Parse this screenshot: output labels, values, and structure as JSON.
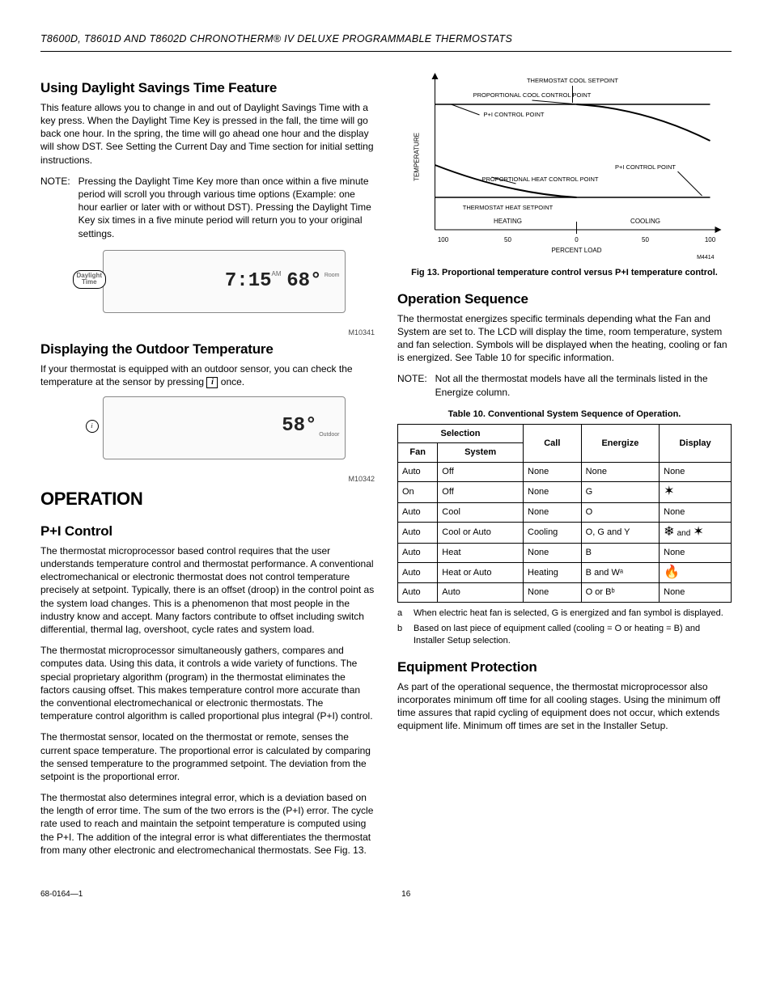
{
  "header": {
    "title": "T8600D, T8601D AND T8602D CHRONOTHERM® IV DELUXE PROGRAMMABLE THERMOSTATS"
  },
  "left": {
    "h_daylight": "Using Daylight Savings Time Feature",
    "p_daylight": "This feature allows you to change in and out of Daylight Savings Time with a key press. When the Daylight Time Key is pressed in the fall, the time will go back one hour. In the spring, the time will go ahead one hour and the display will show DST. See Setting the Current Day and Time section for initial setting instructions.",
    "note_label": "NOTE:",
    "note_daylight": "Pressing the Daylight Time Key more than once within a five minute period will scroll you through various time options (Example: one hour earlier or later with or without DST). Pressing the Daylight Time Key six times in a five minute period will return you to your original settings.",
    "fig1_chip": "Daylight\nTime",
    "fig1_time": "7:15",
    "fig1_ampm": "AM",
    "fig1_temp": "68°",
    "fig1_room": "Room",
    "fig1_code": "M10341",
    "h_outdoor": "Displaying the Outdoor Temperature",
    "p_outdoor_a": "If your thermostat is equipped with an outdoor sensor, you can check the temperature at the sensor by pressing ",
    "p_outdoor_b": " once.",
    "fig2_temp": "58°",
    "fig2_label": "Outdoor",
    "fig2_code": "M10342",
    "h_operation": "OPERATION",
    "h_pi": "P+I Control",
    "p_pi1": "The thermostat microprocessor based control requires that the user understands temperature control and thermostat performance. A conventional electromechanical or electronic thermostat does not control temperature precisely at setpoint. Typically, there is an offset (droop) in the control point as the system load changes. This is a phenomenon that most people in the industry know and accept. Many factors contribute to offset including switch differential, thermal lag, overshoot, cycle rates and system load.",
    "p_pi2": "The thermostat microprocessor simultaneously gathers, compares and computes data. Using this data, it controls a wide variety of functions. The special proprietary algorithm (program) in the thermostat eliminates the factors causing offset. This makes temperature control more accurate than the conventional electromechanical or electronic thermostats. The temperature control algorithm is called proportional plus integral (P+I) control.",
    "p_pi3": "The thermostat sensor, located on the thermostat or remote, senses the current space temperature. The proportional error is calculated by comparing the sensed temperature to the programmed setpoint. The deviation from the setpoint is the proportional error.",
    "p_pi4": "The thermostat also determines integral error, which is a deviation based on the length of error time. The sum of the two errors is the (P+I) error. The cycle rate used to reach and maintain the setpoint temperature is computed using the P+I. The addition of the integral error is what differentiates the thermostat from many other electronic and electromechanical thermostats. See Fig. 13."
  },
  "right": {
    "chart_labels": {
      "ylabel": "TEMPERATURE",
      "l1": "THERMOSTAT COOL SETPOINT",
      "l2": "PROPORTIONAL COOL CONTROL POINT",
      "l3": "P+I CONTROL POINT",
      "l4": "P+I CONTROL POINT",
      "l5": "PROPORTIONAL HEAT CONTROL POINT",
      "l6": "THERMOSTAT HEAT SETPOINT",
      "heating": "HEATING",
      "cooling": "COOLING",
      "xlabel": "PERCENT LOAD",
      "code": "M4414"
    },
    "fig13_caption": "Fig 13. Proportional temperature control versus P+I temperature control.",
    "h_opseq": "Operation Sequence",
    "p_opseq": "The thermostat energizes specific terminals depending what the Fan and System are set to. The LCD will display the time, room temperature, system and fan selection. Symbols will be displayed when the heating, cooling or fan is energized. See Table 10 for specific information.",
    "note_label": "NOTE:",
    "note_opseq": "Not all the thermostat models have all the terminals listed in the Energize column.",
    "tbl_caption": "Table 10. Conventional System Sequence of Operation.",
    "tbl_head": {
      "selection": "Selection",
      "fan": "Fan",
      "system": "System",
      "call": "Call",
      "energize": "Energize",
      "display": "Display"
    },
    "tbl_rows": [
      {
        "fan": "Auto",
        "system": "Off",
        "call": "None",
        "energize": "None",
        "display": "None"
      },
      {
        "fan": "On",
        "system": "Off",
        "call": "None",
        "energize": "G",
        "display": "fan"
      },
      {
        "fan": "Auto",
        "system": "Cool",
        "call": "None",
        "energize": "O",
        "display": "None"
      },
      {
        "fan": "Auto",
        "system": "Cool or Auto",
        "call": "Cooling",
        "energize": "O, G and Y",
        "display": "snow_fan"
      },
      {
        "fan": "Auto",
        "system": "Heat",
        "call": "None",
        "energize": "B",
        "display": "None"
      },
      {
        "fan": "Auto",
        "system": "Heat or Auto",
        "call": "Heating",
        "energize": "B and Wᵃ",
        "display": "flame"
      },
      {
        "fan": "Auto",
        "system": "Auto",
        "call": "None",
        "energize": "O or Bᵇ",
        "display": "None"
      }
    ],
    "fn_a_key": "a",
    "fn_a": "When electric heat fan is selected, G is energized and fan symbol is displayed.",
    "fn_b_key": "b",
    "fn_b": "Based on last piece of equipment called (cooling = O or heating = B) and Installer Setup selection.",
    "h_equip": "Equipment Protection",
    "p_equip": "As part of the operational sequence, the thermostat microprocessor also incorporates minimum off time for all cooling stages. Using the minimum off time assures that rapid cycling of equipment does not occur, which extends equipment life. Minimum off times are set in the Installer Setup."
  },
  "footer": {
    "doc": "68-0164—1",
    "page": "16"
  },
  "chart_data": {
    "type": "line",
    "title": "Proportional temperature control versus P+I temperature control",
    "xlabel": "PERCENT LOAD",
    "ylabel": "TEMPERATURE",
    "x_ticks_heating": [
      100,
      50,
      0
    ],
    "x_ticks_cooling": [
      0,
      50,
      100
    ],
    "series_description": "Qualitative: two horizontal setpoint lines (cool above, heat below); P+I control points flat at setpoints; proportional cool control point curves upward away from cool setpoint as cooling load increases; proportional heat control point curves downward away from heat setpoint as heating load increases.",
    "annotations": [
      "THERMOSTAT COOL SETPOINT",
      "PROPORTIONAL COOL CONTROL POINT",
      "P+I CONTROL POINT",
      "PROPORTIONAL HEAT CONTROL POINT",
      "THERMOSTAT HEAT SETPOINT",
      "HEATING",
      "COOLING"
    ]
  }
}
